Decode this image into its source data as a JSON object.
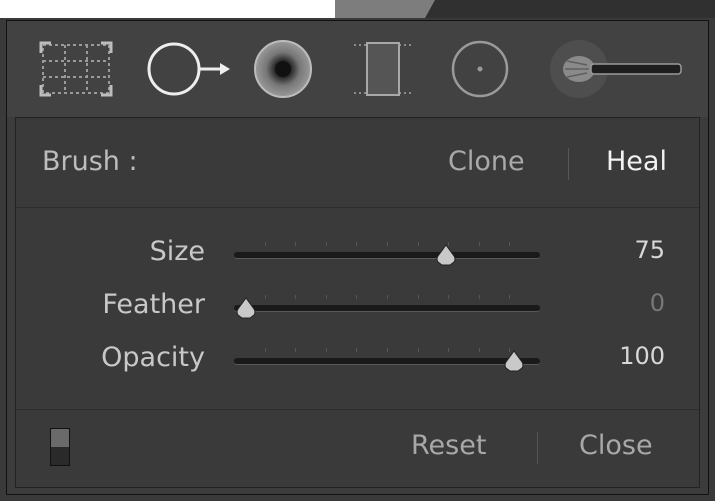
{
  "tools": [
    {
      "icon": "crop-overlay-icon"
    },
    {
      "icon": "spot-removal-icon"
    },
    {
      "icon": "red-eye-correction-icon"
    },
    {
      "icon": "graduated-filter-icon"
    },
    {
      "icon": "radial-filter-icon"
    },
    {
      "icon": "adjustment-brush-icon"
    }
  ],
  "brush": {
    "label": "Brush :",
    "modes": {
      "clone": "Clone",
      "heal": "Heal"
    },
    "selected": "Heal"
  },
  "sliders": [
    {
      "label": "Size",
      "value": "75",
      "fraction": 0.71
    },
    {
      "label": "Feather",
      "value": "0",
      "fraction": 0.0
    },
    {
      "label": "Opacity",
      "value": "100",
      "fraction": 0.95
    }
  ],
  "footer": {
    "reset_label": "Reset",
    "close_label": "Close"
  }
}
